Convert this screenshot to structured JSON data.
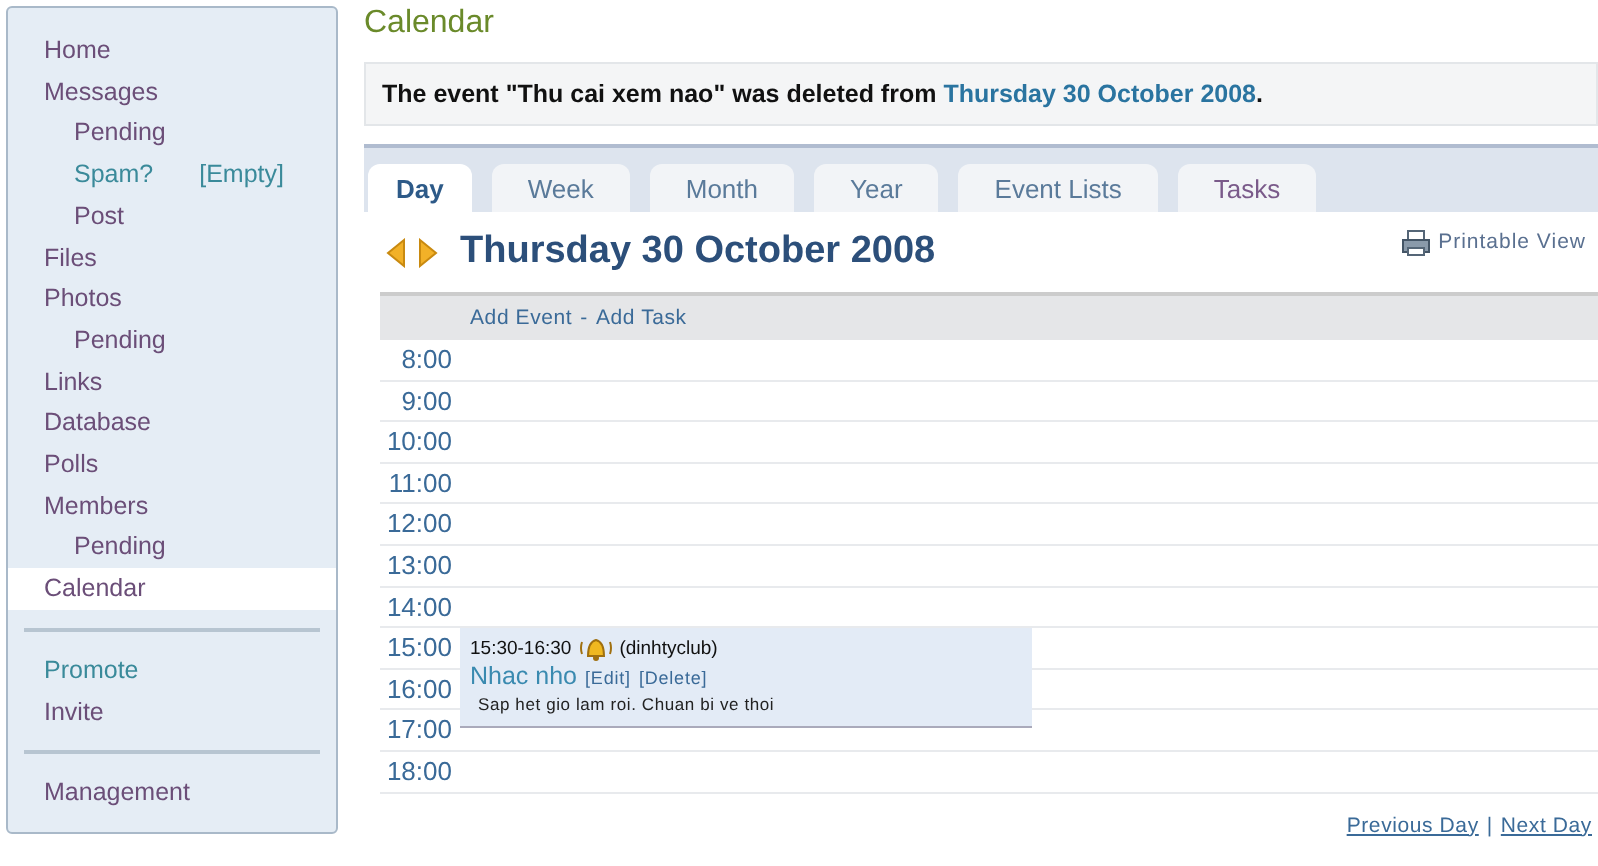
{
  "sidebar": {
    "items": [
      {
        "label": "Home",
        "kind": "item",
        "selected": false,
        "color": "#6b4e78"
      },
      {
        "label": "Messages",
        "kind": "item",
        "selected": false,
        "color": "#6b4e78"
      },
      {
        "label": "Pending",
        "kind": "sub",
        "selected": false,
        "color": "#6b4e78"
      },
      {
        "label": "Spam?",
        "kind": "sub",
        "selected": false,
        "color": "#3a8a9a",
        "extra": "[Empty]"
      },
      {
        "label": "Post",
        "kind": "sub",
        "selected": false,
        "color": "#6b4e78"
      },
      {
        "label": "Files",
        "kind": "item",
        "selected": false,
        "color": "#6b4e78"
      },
      {
        "label": "Photos",
        "kind": "item",
        "selected": false,
        "color": "#6b4e78"
      },
      {
        "label": "Pending",
        "kind": "sub",
        "selected": false,
        "color": "#6b4e78"
      },
      {
        "label": "Links",
        "kind": "item",
        "selected": false,
        "color": "#6b4e78"
      },
      {
        "label": "Database",
        "kind": "item",
        "selected": false,
        "color": "#6b4e78"
      },
      {
        "label": "Polls",
        "kind": "item",
        "selected": false,
        "color": "#6b4e78"
      },
      {
        "label": "Members",
        "kind": "item",
        "selected": false,
        "color": "#6b4e78"
      },
      {
        "label": "Pending",
        "kind": "sub",
        "selected": false,
        "color": "#6b4e78"
      },
      {
        "label": "Calendar",
        "kind": "item",
        "selected": true,
        "color": "#6b4e78"
      },
      {
        "kind": "separator"
      },
      {
        "label": "Promote",
        "kind": "item",
        "selected": false,
        "color": "#3a8a9a"
      },
      {
        "label": "Invite",
        "kind": "item",
        "selected": false,
        "color": "#6b4e78"
      },
      {
        "kind": "separator"
      },
      {
        "label": "Management",
        "kind": "item",
        "selected": false,
        "color": "#6b4e78"
      }
    ]
  },
  "page_title": "Calendar",
  "notice": {
    "text": "The event \"Thu cai xem nao\" was deleted from ",
    "link": "Thursday 30 October 2008",
    "end": "."
  },
  "tabs": [
    {
      "label": "Day",
      "selected": true
    },
    {
      "label": "Week",
      "selected": false
    },
    {
      "label": "Month",
      "selected": false
    },
    {
      "label": "Year",
      "selected": false
    },
    {
      "label": "Event Lists",
      "selected": false
    },
    {
      "label": "Tasks",
      "selected": false
    }
  ],
  "date_heading": "Thursday 30 October 2008",
  "printable_view": "Printable View",
  "add_event": "Add Event",
  "add_separator": "-",
  "add_task": "Add Task",
  "hours": [
    {
      "time": "8:00"
    },
    {
      "time": "9:00"
    },
    {
      "time": "10:00"
    },
    {
      "time": "11:00"
    },
    {
      "time": "12:00"
    },
    {
      "time": "13:00"
    },
    {
      "time": "14:00"
    },
    {
      "time": "15:00",
      "event": {
        "time": "15:30-16:30",
        "owner": "(dinhtyclub)",
        "title": "Nhac nho",
        "edit": "[Edit]",
        "delete": "[Delete]",
        "description": "Sap het gio lam roi. Chuan bi ve thoi"
      }
    },
    {
      "time": "16:00"
    },
    {
      "time": "17:00"
    },
    {
      "time": "18:00"
    }
  ],
  "footer": {
    "previous": "Previous Day",
    "separator": "|",
    "next": "Next Day"
  }
}
